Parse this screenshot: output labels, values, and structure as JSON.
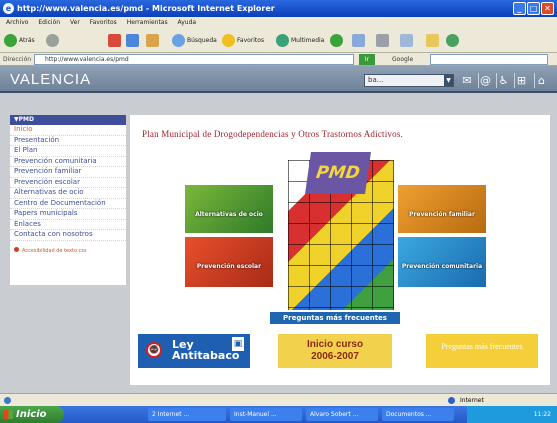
{
  "window": {
    "title": "http://www.valencia.es/pmd - Microsoft Internet Explorer",
    "min": "_",
    "max": "□",
    "close": "✕",
    "logo": "e"
  },
  "menu": [
    "Archivo",
    "Edición",
    "Ver",
    "Favoritos",
    "Herramientas",
    "Ayuda"
  ],
  "toolbar": {
    "back": "Atrás",
    "search": "Búsqueda",
    "favorites": "Favoritos",
    "media": "Multimedia"
  },
  "addressbar": {
    "label": "Dirección",
    "url": "http://www.valencia.es/pmd",
    "go": "Ir",
    "google": "Google"
  },
  "site": {
    "logo": "VALENCIA",
    "search_value": "ba..."
  },
  "sidebar": {
    "header": "▼PMD",
    "items": [
      "Inicio",
      "Presentación",
      "El Plan",
      "Prevención comunitaria",
      "Prevención familiar",
      "Prevención escolar",
      "Alternativas de ocio",
      "Centro de Documentación",
      "Papers municipals",
      "Enlaces",
      "Contacta con nosotros"
    ],
    "footer": "Accesibilidad de texto css"
  },
  "main": {
    "banner": "Plan Municipal de Drogodependencias y Otros Trastornos Adictivos.",
    "pmd_logo": "PMD",
    "tiles": [
      "Alternativas de ocio",
      "Prevención familiar",
      "Prevención escolar",
      "Prevención comunitaria"
    ],
    "faq": "Preguntas más frecuentes",
    "ley_line1": "Ley",
    "ley_line2": "Antitabaco",
    "ley_icon": "🚭",
    "curso_line1": "Inicio curso",
    "curso_line2": "2006-2007",
    "other_banner": "Preguntas más frecuentes"
  },
  "statusbar": {
    "zone": "Internet"
  },
  "taskbar": {
    "start": "Inicio",
    "tasks": [
      "2 Internet ...",
      "Inst-Manuel ...",
      "Alvaro Sobert ...",
      "Documentos ..."
    ],
    "clock": "11:22"
  }
}
